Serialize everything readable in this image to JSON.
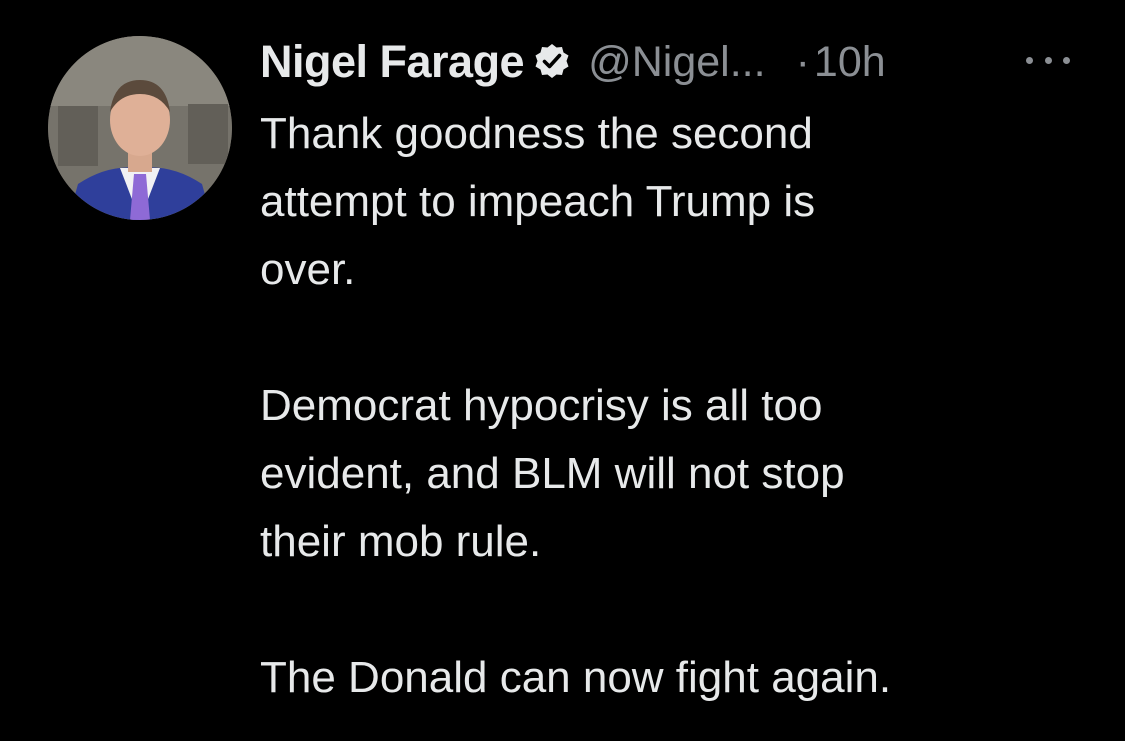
{
  "tweet": {
    "display_name": "Nigel Farage",
    "handle": "@Nigel...",
    "separator": "·",
    "time": "10h",
    "verified_icon": "verified-badge-icon",
    "more_icon": "more-options-icon",
    "avatar_icon": "profile-avatar",
    "paragraphs": [
      [
        "Thank goodness the second",
        "attempt to impeach Trump is",
        "over."
      ],
      [
        "Democrat hypocrisy is all too",
        "evident, and BLM will not stop",
        "their mob rule."
      ],
      [
        "The Donald can now fight again."
      ]
    ]
  },
  "colors": {
    "background": "#000000",
    "primary_text": "#e7e9ea",
    "secondary_text": "#8b8f94"
  }
}
